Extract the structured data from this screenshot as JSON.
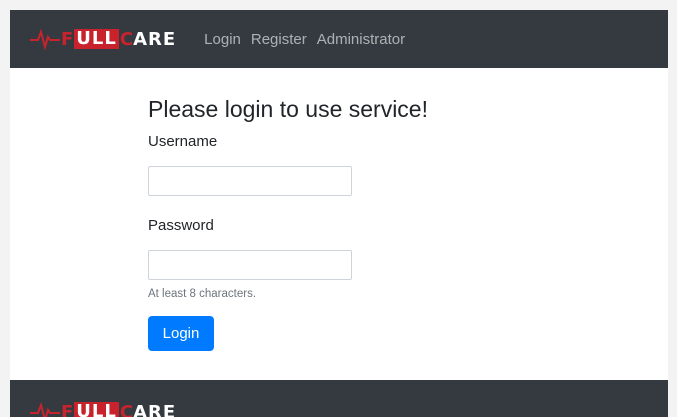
{
  "brand": {
    "letter_f": "F",
    "boxed": "ULL",
    "letter_c": "C",
    "tail": "ARE",
    "accent_color": "#c8232c"
  },
  "nav": {
    "items": [
      {
        "label": "Login"
      },
      {
        "label": "Register"
      },
      {
        "label": "Administrator"
      }
    ]
  },
  "form": {
    "title": "Please login to use service!",
    "username_label": "Username",
    "username_value": "",
    "password_label": "Password",
    "password_value": "",
    "password_hint": "At least 8 characters.",
    "submit_label": "Login",
    "submit_color": "#007bff"
  },
  "colors": {
    "navbar_bg": "#343a40",
    "page_bg": "#f3f3f3"
  }
}
